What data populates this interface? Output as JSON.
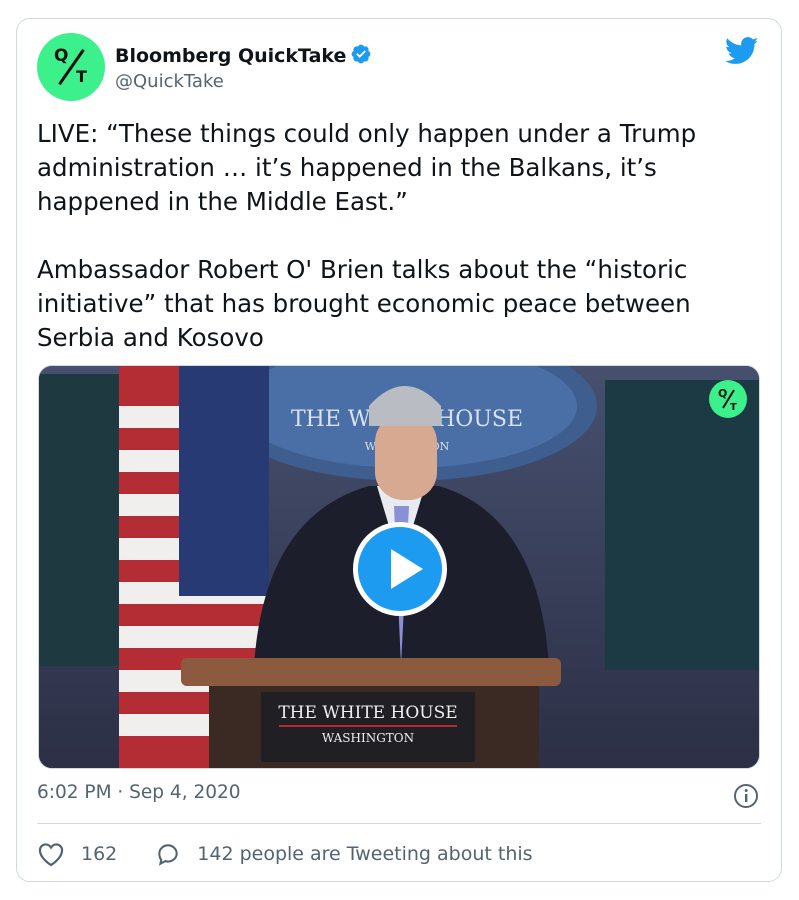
{
  "account": {
    "name": "Bloomberg QuickTake",
    "handle": "@QuickTake",
    "avatar_letters": "Q/T"
  },
  "tweet": {
    "lines_p1": [
      "LIVE: “These things could only happen under a Trump",
      "administration … it’s happened in the Balkans, it’s",
      "happened in the Middle East.”"
    ],
    "lines_p2": [
      "Ambassador Robert O' Brien talks about the “historic",
      "initiative” that has brought economic peace between",
      "Serbia and Kosovo"
    ],
    "timestamp": "6:02 PM · Sep 4, 2020"
  },
  "media": {
    "podium_title": "THE WHITE HOUSE",
    "podium_subtitle": "WASHINGTON",
    "seal_text": "THE WHITE HOUSE",
    "seal_sub": "WASHINGTON"
  },
  "engagement": {
    "likes": "162",
    "replies_text": "142 people are Tweeting about this"
  },
  "colors": {
    "accent": "#1d9bf0",
    "brand_green": "#3cf08c",
    "secondary_text": "#536471",
    "border": "#cfd9de"
  },
  "icons": [
    "twitter-bird-icon",
    "verified-badge-icon",
    "play-icon",
    "info-icon",
    "heart-icon",
    "reply-bubble-icon"
  ]
}
